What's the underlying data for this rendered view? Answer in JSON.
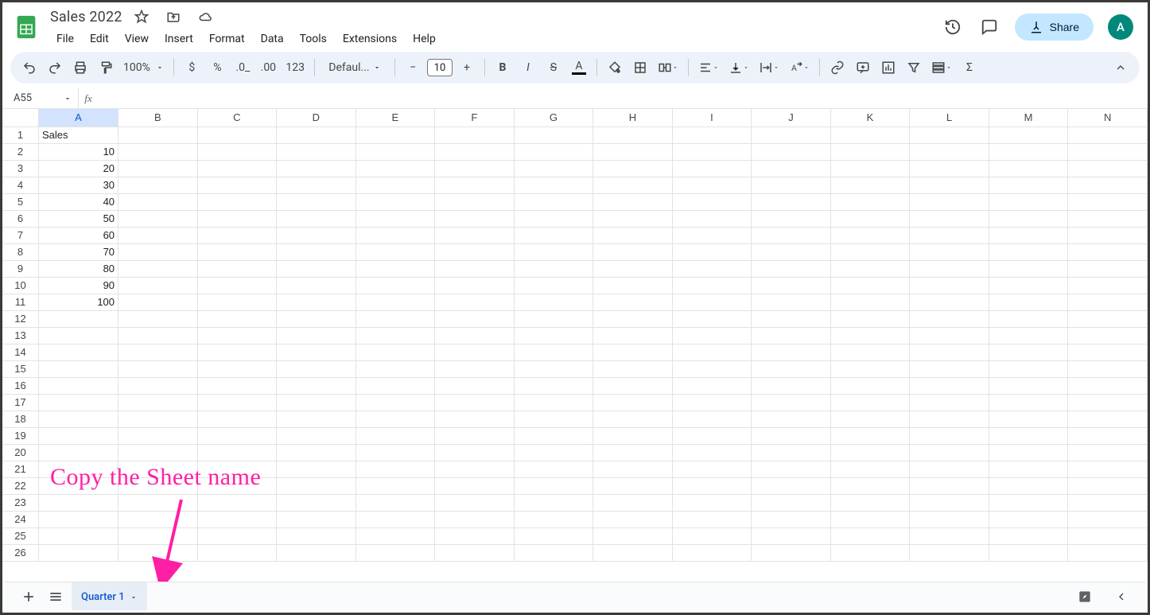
{
  "doc": {
    "title": "Sales 2022"
  },
  "menus": [
    "File",
    "Edit",
    "View",
    "Insert",
    "Format",
    "Data",
    "Tools",
    "Extensions",
    "Help"
  ],
  "share_label": "Share",
  "avatar_letter": "A",
  "toolbar": {
    "zoom": "100%",
    "font_name": "Defaul...",
    "font_size": "10",
    "number_label": "123"
  },
  "name_box": "A55",
  "formula": "",
  "columns": [
    "A",
    "B",
    "C",
    "D",
    "E",
    "F",
    "G",
    "H",
    "I",
    "J",
    "K",
    "L",
    "M",
    "N"
  ],
  "rows": 26,
  "selected_col": "A",
  "cells": {
    "A1": {
      "v": "Sales",
      "t": "text"
    },
    "A2": {
      "v": "10"
    },
    "A3": {
      "v": "20"
    },
    "A4": {
      "v": "30"
    },
    "A5": {
      "v": "40"
    },
    "A6": {
      "v": "50"
    },
    "A7": {
      "v": "60"
    },
    "A8": {
      "v": "70"
    },
    "A9": {
      "v": "80"
    },
    "A10": {
      "v": "90"
    },
    "A11": {
      "v": "100"
    }
  },
  "sheet_tab": "Quarter 1",
  "annotation_text": "Copy the Sheet name"
}
